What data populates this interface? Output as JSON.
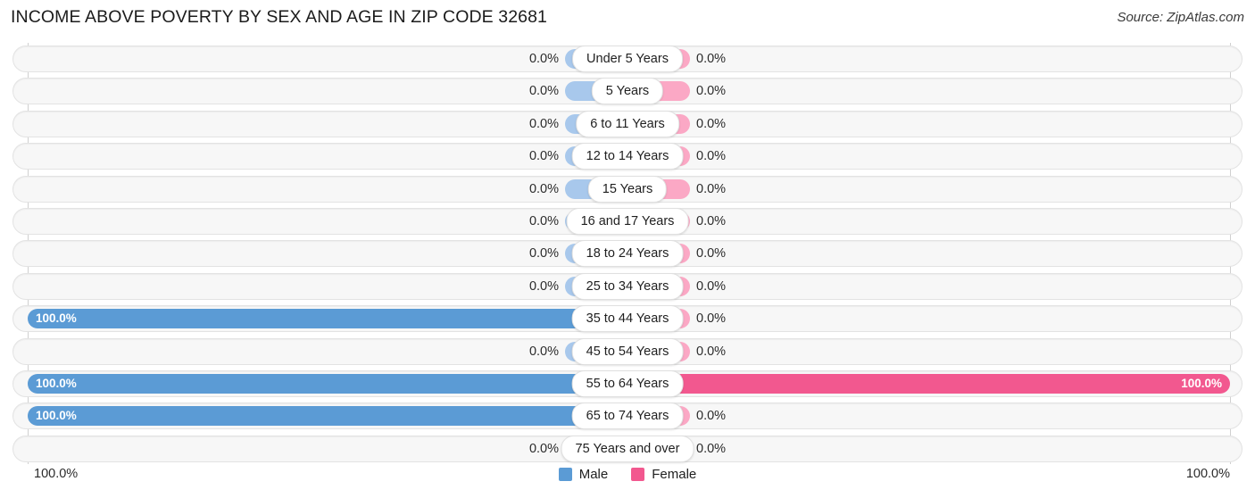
{
  "header": {
    "title": "INCOME ABOVE POVERTY BY SEX AND AGE IN ZIP CODE 32681",
    "source": "Source: ZipAtlas.com"
  },
  "axis": {
    "left_tick": "100.0%",
    "right_tick": "100.0%"
  },
  "legend": {
    "items": [
      {
        "label": "Male",
        "color": "#5b9bd5"
      },
      {
        "label": "Female",
        "color": "#f2588f"
      }
    ]
  },
  "colors": {
    "male_full": "#5b9bd5",
    "male_zero": "#a8c8ec",
    "female_full": "#f2588f",
    "female_zero": "#fba8c5",
    "track": "#f7f7f7"
  },
  "chart_data": {
    "type": "bar",
    "title": "INCOME ABOVE POVERTY BY SEX AND AGE IN ZIP CODE 32681",
    "subtitle": "Source: ZipAtlas.com",
    "orientation": "horizontal-diverging",
    "xlabel": "",
    "ylabel": "",
    "xlim": [
      -100,
      100
    ],
    "axis_tick_labels": [
      "100.0%",
      "100.0%"
    ],
    "grid": false,
    "legend_position": "bottom-center",
    "categories": [
      "Under 5 Years",
      "5 Years",
      "6 to 11 Years",
      "12 to 14 Years",
      "15 Years",
      "16 and 17 Years",
      "18 to 24 Years",
      "25 to 34 Years",
      "35 to 44 Years",
      "45 to 54 Years",
      "55 to 64 Years",
      "65 to 74 Years",
      "75 Years and over"
    ],
    "series": [
      {
        "name": "Male",
        "values": [
          0.0,
          0.0,
          0.0,
          0.0,
          0.0,
          0.0,
          0.0,
          0.0,
          100.0,
          0.0,
          100.0,
          100.0,
          0.0
        ]
      },
      {
        "name": "Female",
        "values": [
          0.0,
          0.0,
          0.0,
          0.0,
          0.0,
          0.0,
          0.0,
          0.0,
          0.0,
          0.0,
          100.0,
          0.0,
          0.0
        ]
      }
    ]
  },
  "rows": [
    {
      "label": "Under 5 Years",
      "male": "0.0%",
      "female": "0.0%",
      "male_full": false,
      "female_full": false
    },
    {
      "label": "5 Years",
      "male": "0.0%",
      "female": "0.0%",
      "male_full": false,
      "female_full": false
    },
    {
      "label": "6 to 11 Years",
      "male": "0.0%",
      "female": "0.0%",
      "male_full": false,
      "female_full": false
    },
    {
      "label": "12 to 14 Years",
      "male": "0.0%",
      "female": "0.0%",
      "male_full": false,
      "female_full": false
    },
    {
      "label": "15 Years",
      "male": "0.0%",
      "female": "0.0%",
      "male_full": false,
      "female_full": false
    },
    {
      "label": "16 and 17 Years",
      "male": "0.0%",
      "female": "0.0%",
      "male_full": false,
      "female_full": false
    },
    {
      "label": "18 to 24 Years",
      "male": "0.0%",
      "female": "0.0%",
      "male_full": false,
      "female_full": false
    },
    {
      "label": "25 to 34 Years",
      "male": "0.0%",
      "female": "0.0%",
      "male_full": false,
      "female_full": false
    },
    {
      "label": "35 to 44 Years",
      "male": "100.0%",
      "female": "0.0%",
      "male_full": true,
      "female_full": false
    },
    {
      "label": "45 to 54 Years",
      "male": "0.0%",
      "female": "0.0%",
      "male_full": false,
      "female_full": false
    },
    {
      "label": "55 to 64 Years",
      "male": "100.0%",
      "female": "100.0%",
      "male_full": true,
      "female_full": true
    },
    {
      "label": "65 to 74 Years",
      "male": "100.0%",
      "female": "0.0%",
      "male_full": true,
      "female_full": false
    },
    {
      "label": "75 Years and over",
      "male": "0.0%",
      "female": "0.0%",
      "male_full": false,
      "female_full": false
    }
  ]
}
